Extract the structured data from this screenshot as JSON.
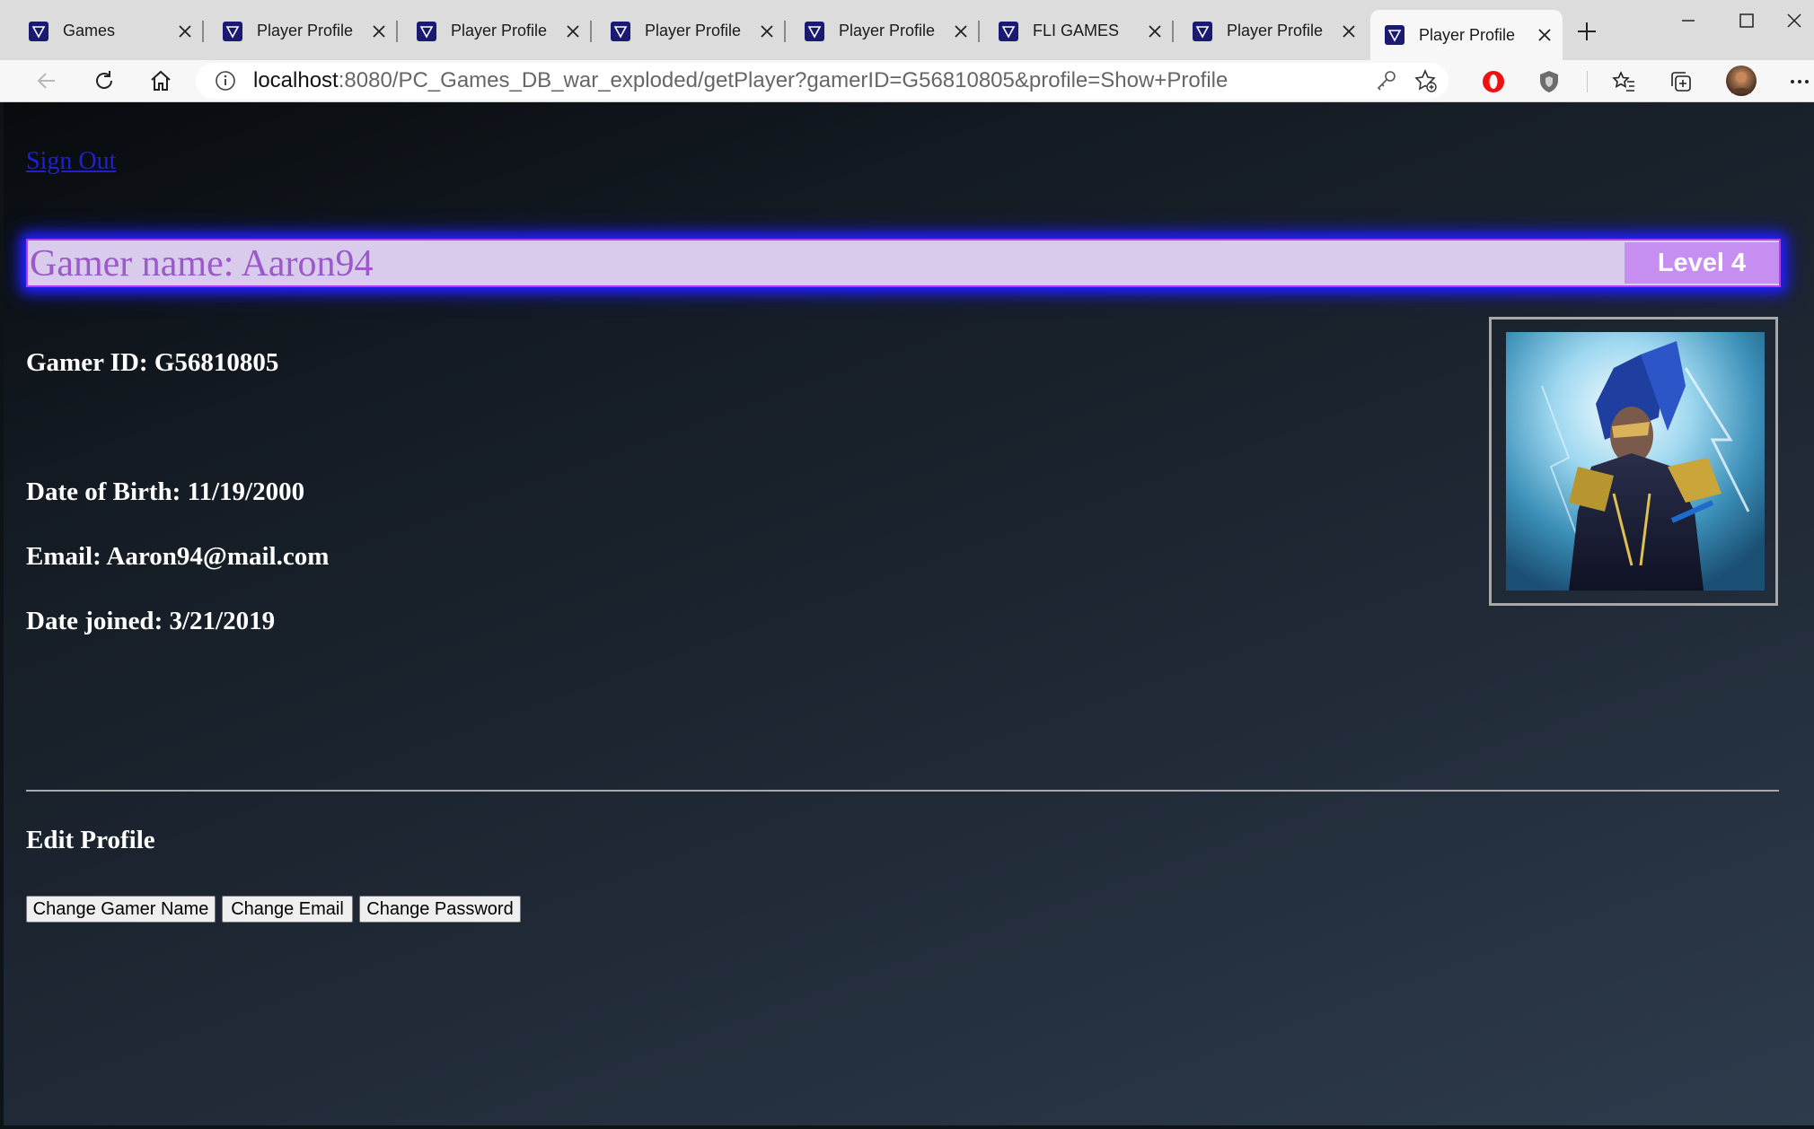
{
  "browser": {
    "tabs": [
      {
        "label": "Games",
        "active": false
      },
      {
        "label": "Player Profile",
        "active": false
      },
      {
        "label": "Player Profile",
        "active": false
      },
      {
        "label": "Player Profile",
        "active": false
      },
      {
        "label": "Player Profile",
        "active": false
      },
      {
        "label": "FLI GAMES",
        "active": false
      },
      {
        "label": "Player Profile",
        "active": false
      },
      {
        "label": "Player Profile",
        "active": true
      }
    ],
    "url_host": "localhost",
    "url_rest": ":8080/PC_Games_DB_war_exploded/getPlayer?gamerID=G56810805&profile=Show+Profile",
    "icons": [
      "back-icon",
      "refresh-icon",
      "home-icon",
      "info-icon",
      "key-icon",
      "add-favorite-icon",
      "opera-extension-icon",
      "shield-extension-icon",
      "favorites-icon",
      "collections-icon",
      "profile-avatar",
      "more-icon",
      "minimize-icon",
      "maximize-icon",
      "close-icon",
      "new-tab-icon"
    ]
  },
  "page": {
    "sign_out": "Sign Out",
    "gamer_name": "Gamer name: Aaron94",
    "level": "Level 4",
    "gamer_id": "Gamer ID: G56810805",
    "dob": "Date of Birth: 11/19/2000",
    "email": "Email: Aaron94@mail.com",
    "date_joined": "Date joined: 3/21/2019",
    "edit_title": "Edit Profile",
    "buttons": {
      "change_name": "Change Gamer Name",
      "change_email": "Change Email",
      "change_password": "Change Password"
    }
  },
  "colors": {
    "name_bar_bg": "#d8cbec",
    "name_text": "#9b59c9",
    "level_bg": "#c58ef0",
    "glow": "#2020ff",
    "link": "#1f1fd6"
  }
}
